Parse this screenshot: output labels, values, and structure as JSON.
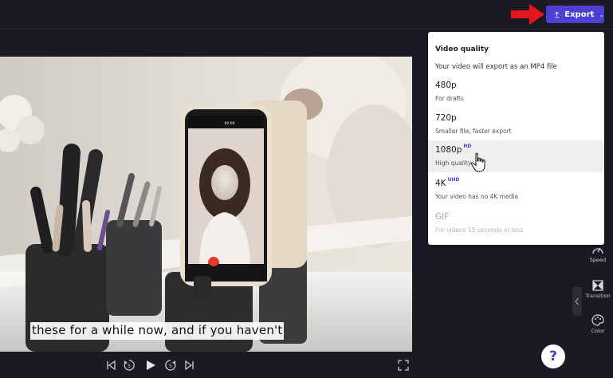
{
  "header": {
    "export_label": "Export",
    "export_color": "#4b3fd4"
  },
  "export_menu": {
    "title": "Video quality",
    "subtitle": "Your video will export as an MP4 file",
    "options": [
      {
        "name": "480p",
        "badge": "",
        "description": "For drafts",
        "state": "normal"
      },
      {
        "name": "720p",
        "badge": "",
        "description": "Smaller file, faster export",
        "state": "normal"
      },
      {
        "name": "1080p",
        "badge": "HD",
        "description": "High quality",
        "state": "hover"
      },
      {
        "name": "4K",
        "badge": "UHD",
        "description": "Your video has no 4K media",
        "state": "normal"
      },
      {
        "name": "GIF",
        "badge": "",
        "description": "For videos 15 seconds or less",
        "state": "disabled"
      }
    ]
  },
  "preview": {
    "caption": "these for a while now, and if you haven't",
    "phone_time": "00:00"
  },
  "playback": {
    "controls": [
      "skip-back-icon",
      "rewind-5-icon",
      "play-icon",
      "forward-5-icon",
      "skip-forward-icon",
      "fullscreen-icon"
    ]
  },
  "sidebar_tools": [
    {
      "label": "Speed",
      "icon": "speedometer-icon"
    },
    {
      "label": "Transition",
      "icon": "transition-icon"
    },
    {
      "label": "Color",
      "icon": "palette-icon"
    }
  ],
  "help": {
    "label": "?"
  },
  "colors": {
    "background": "#1b1a24",
    "accent": "#4b3fd4",
    "annotation_arrow": "#e8141b"
  }
}
